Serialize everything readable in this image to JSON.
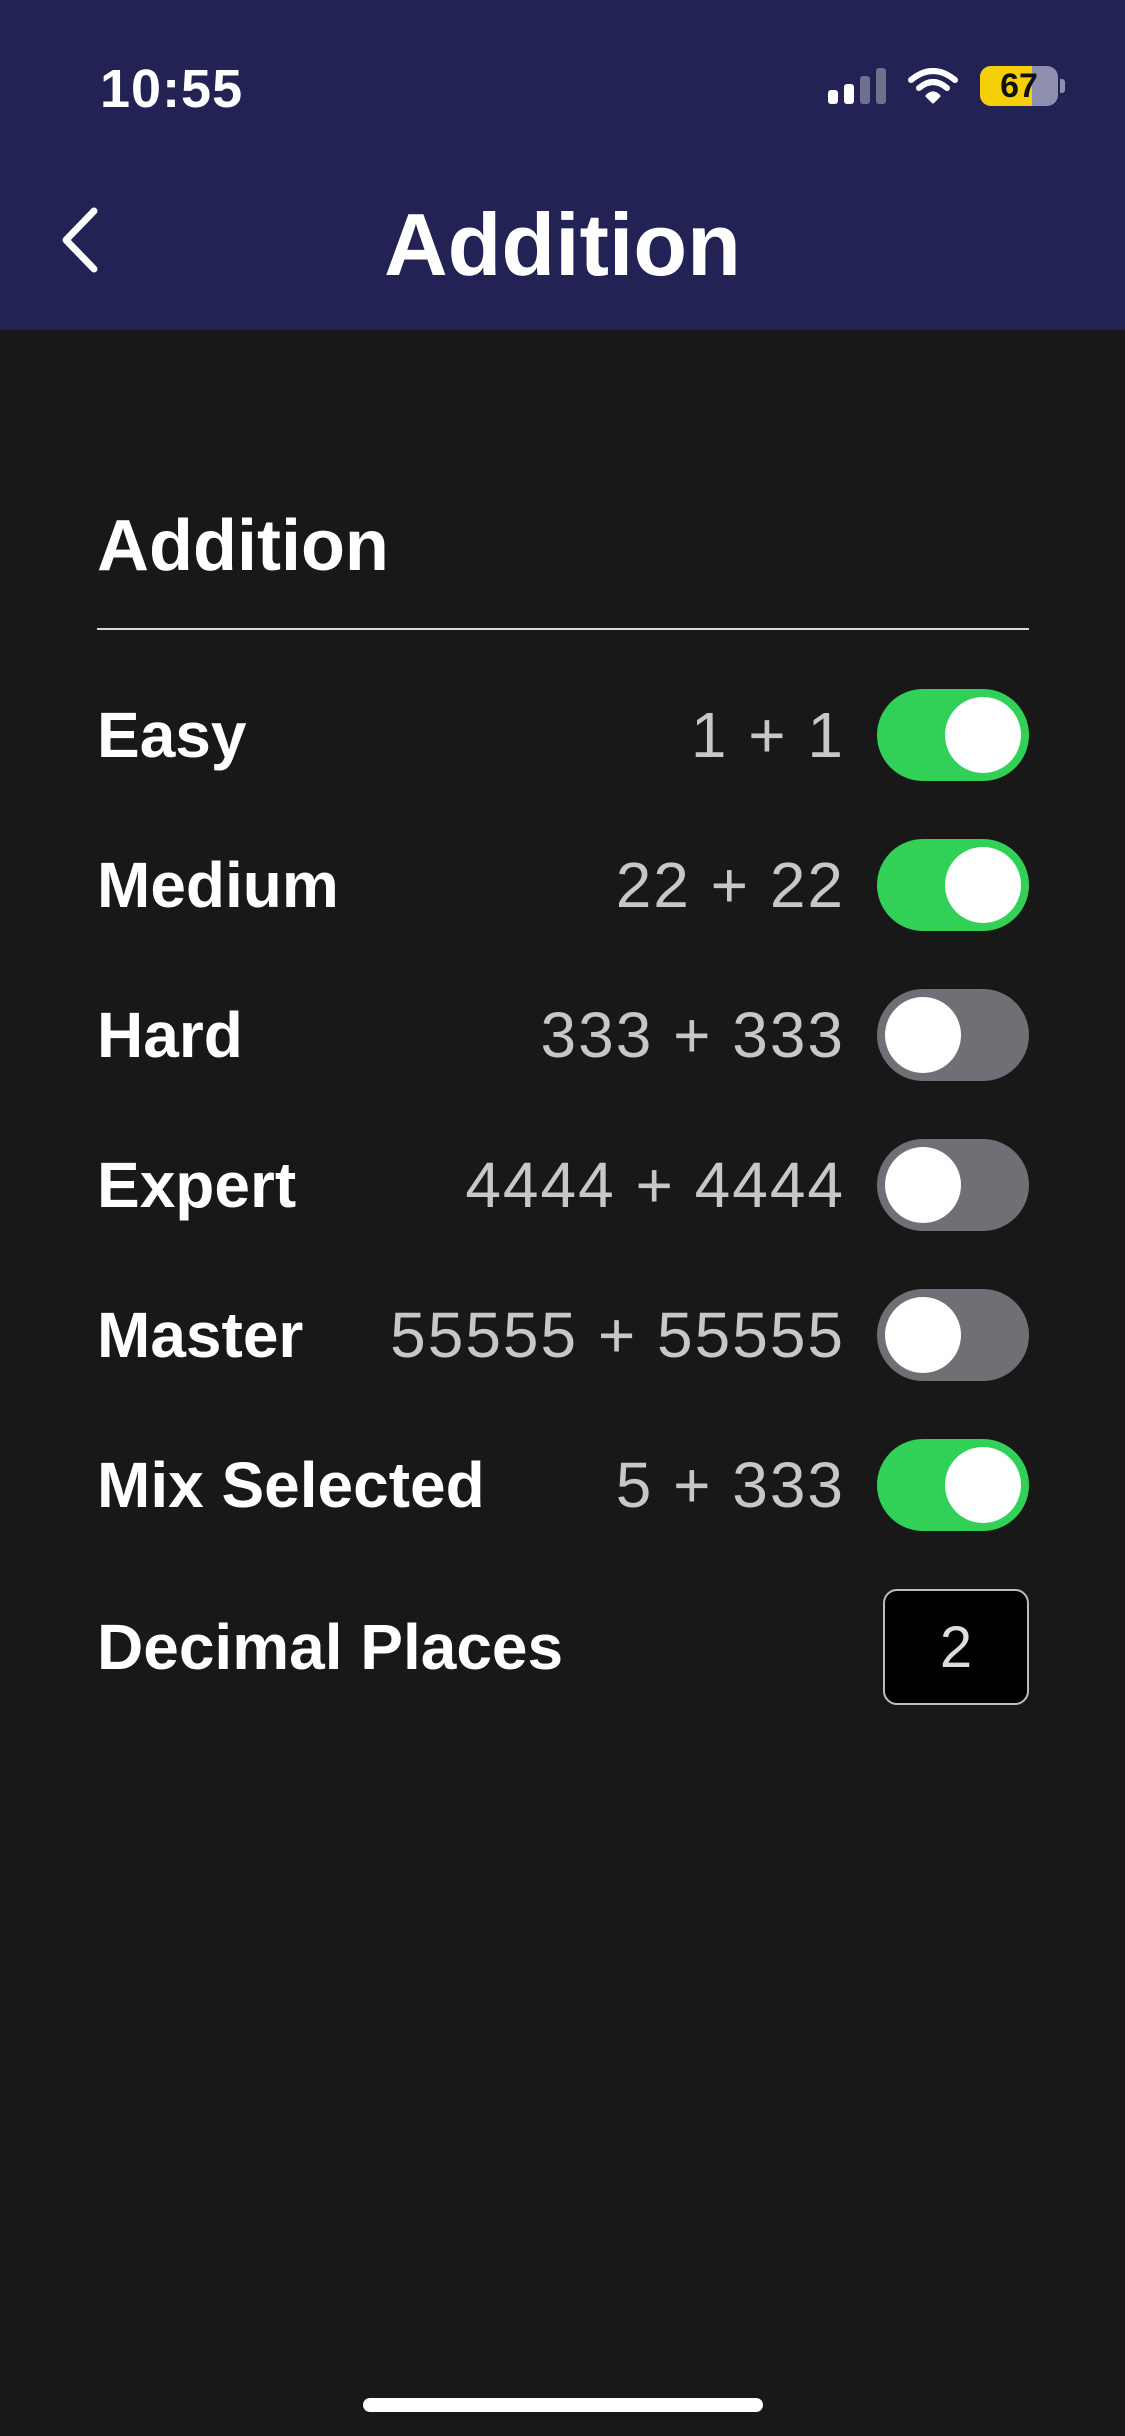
{
  "status_bar": {
    "time": "10:55",
    "battery_percent": "67",
    "battery_level": 0.67,
    "signal_bars": 4,
    "signal_active": 2,
    "icons": [
      "cellular-signal-icon",
      "wifi-icon",
      "battery-icon"
    ]
  },
  "nav": {
    "title": "Addition",
    "back_icon": "chevron-left-icon"
  },
  "section": {
    "title": "Addition"
  },
  "rows": [
    {
      "label": "Easy",
      "example": "1 + 1",
      "enabled": true
    },
    {
      "label": "Medium",
      "example": "22 + 22",
      "enabled": true
    },
    {
      "label": "Hard",
      "example": "333 + 333",
      "enabled": false
    },
    {
      "label": "Expert",
      "example": "4444 + 4444",
      "enabled": false
    },
    {
      "label": "Master",
      "example": "55555 + 55555",
      "enabled": false
    },
    {
      "label": "Mix Selected",
      "example": "5 + 333",
      "enabled": true
    }
  ],
  "decimal": {
    "label": "Decimal Places",
    "value": "2"
  },
  "colors": {
    "header_bg": "#232255",
    "page_bg": "#181818",
    "toggle_on": "#31d158",
    "toggle_off": "#6f6f75",
    "battery_fill": "#f5cf0a"
  }
}
